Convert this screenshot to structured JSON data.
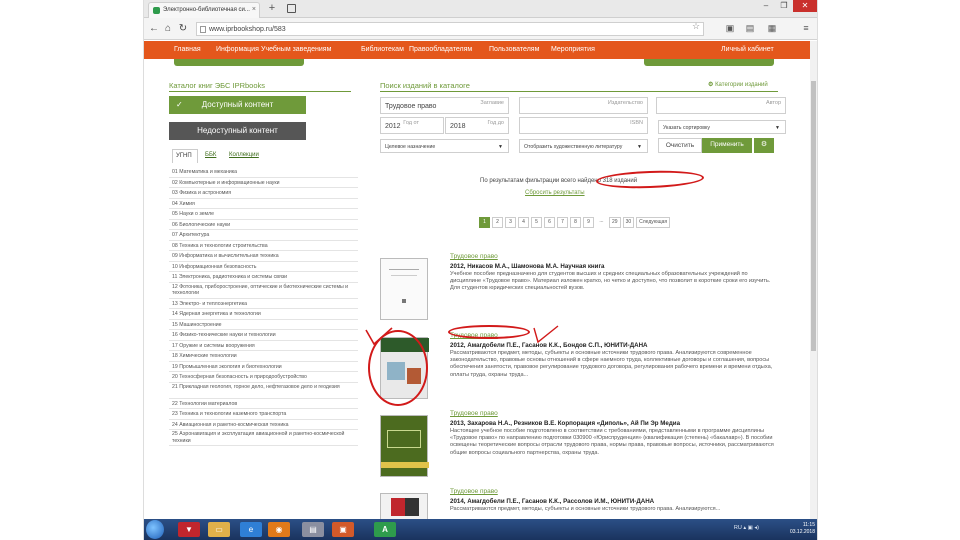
{
  "browser": {
    "tab_title": "Электронно-библиотечная си...",
    "new_tab": "+",
    "url": "www.iprbookshop.ru/583",
    "window_controls": [
      "–",
      "❐",
      "✕"
    ]
  },
  "site_nav": [
    "Главная",
    "Информация",
    "Учебным заведениям",
    "Библиотекам",
    "Правообладателям",
    "Пользователям",
    "Мероприятия",
    "Личный кабинет"
  ],
  "catalog": {
    "title": "Каталог книг ЭБС IPRbooks",
    "available": "Доступный контент",
    "unavailable": "Недоступный контент",
    "sort_tabs": [
      "УГНП",
      "ББК",
      "Коллекции"
    ],
    "categories": [
      "01 Математика и механика",
      "02 Компьютерные и информационные науки",
      "03 Физика и астрономия",
      "04 Химия",
      "05 Науки о земле",
      "06 Биологические науки",
      "07 Архитектура",
      "08 Техника и технологии строительства",
      "09 Информатика и вычислительная техника",
      "10 Информационная безопасность",
      "11 Электроника, радиотехника и системы связи",
      "12 Фотоника, приборостроение, оптические и биотехнические системы и технологии",
      "13 Электро- и теплоэнергетика",
      "14 Ядерная энергетика и технологии",
      "15 Машиностроение",
      "16 Физико-технические науки и технологии",
      "17 Оружие и системы вооружения",
      "18 Химические технологии",
      "19 Промышленная экология и биотехнологии",
      "20 Техносферная безопасность и природообустройство",
      "21 Прикладная геология, горное дело, нефтегазовое дело и геодезия",
      "22 Технологии материалов",
      "23 Техника и технологии наземного транспорта",
      "24 Авиационная и ракетно-космическая техника",
      "25 Аэронавигация и эксплуатация авиационной и ракетно-космической техники"
    ]
  },
  "search": {
    "title": "Поиск изданий в каталоге",
    "categories_link": "Категории изданий",
    "field1_value": "Трудовое право",
    "field1_placeholder": "Заглавие",
    "field2_placeholder": "Издательство",
    "field3_placeholder": "Автор",
    "year_from": "2012",
    "year_from_placeholder": "Год от",
    "year_to": "2018",
    "year_to_placeholder": "Год до",
    "isbn_placeholder": "ISBN",
    "sort_select": "Указать сортировку",
    "kind_select": "Целевое назначение",
    "fiction_select": "Отобразить художественную литературу",
    "clear_btn": "Очистить",
    "apply_btn": "Применить",
    "results_text": "По результатам фильтрации всего найдено 318 изданий",
    "reset_link": "Сбросить результаты"
  },
  "pager": [
    "1",
    "2",
    "3",
    "4",
    "5",
    "6",
    "7",
    "8",
    "9",
    "...",
    "29",
    "30",
    "Следующая"
  ],
  "books": [
    {
      "category": "Трудовое право",
      "title": "2012, Никасов М.А., Шамонова М.А. Научная книга",
      "desc": "Учебное пособие предназначено для студентов высших и средних специальных образовательных учреждений по дисциплине «Трудовое право». Материал изложен кратко, но четко и доступно, что позволит в короткие сроки его изучить. Для студентов юридических специальностей вузов."
    },
    {
      "category": "Трудовое право",
      "title": "2012, Амагдобели П.Е., Гасанов К.К., Бондов С.П., ЮНИТИ-ДАНА",
      "desc": "Рассматриваются предмет, методы, субъекты и основные источники трудового права. Анализируются современное законодательство, правовые основы отношений в сфере наемного труда, коллективные договоры и соглашения, вопросы обеспечения занятости, правовое регулирование трудового договора, регулирования рабочего времени и времени отдыха, оплаты труда, охраны труда..."
    },
    {
      "category": "Трудовое право",
      "title": "2013, Захарова Н.А., Резников В.Е. Корпорация «Диполь», Ай Пи Эр Медиа",
      "desc": "Настоящее учебное пособие подготовлено в соответствии с требованиями, представленными в программе дисциплины «Трудовое право» по направлению подготовки 030900 «Юриспруденция» (квалификация (степень) «бакалавр»). В пособии освещены теоретические вопросы отрасли трудового права, нормы права, правовые вопросы, источники, рассматриваются общие вопросы социального партнерства, охраны труда."
    },
    {
      "category": "Трудовое право",
      "title": "2014, Амагдобели П.Е., Гасанов К.К., Рассолов И.М., ЮНИТИ-ДАНА",
      "desc": "Рассматриваются предмет, методы, субъекты и основные источники трудового права. Анализируются..."
    }
  ],
  "taskbar": {
    "lang": "RU",
    "time": "11:15",
    "date": "03.12.2018"
  },
  "colors": {
    "nav_orange": "#e4571c",
    "green": "#6f9a3a",
    "annotation_red": "#d21a1a"
  }
}
